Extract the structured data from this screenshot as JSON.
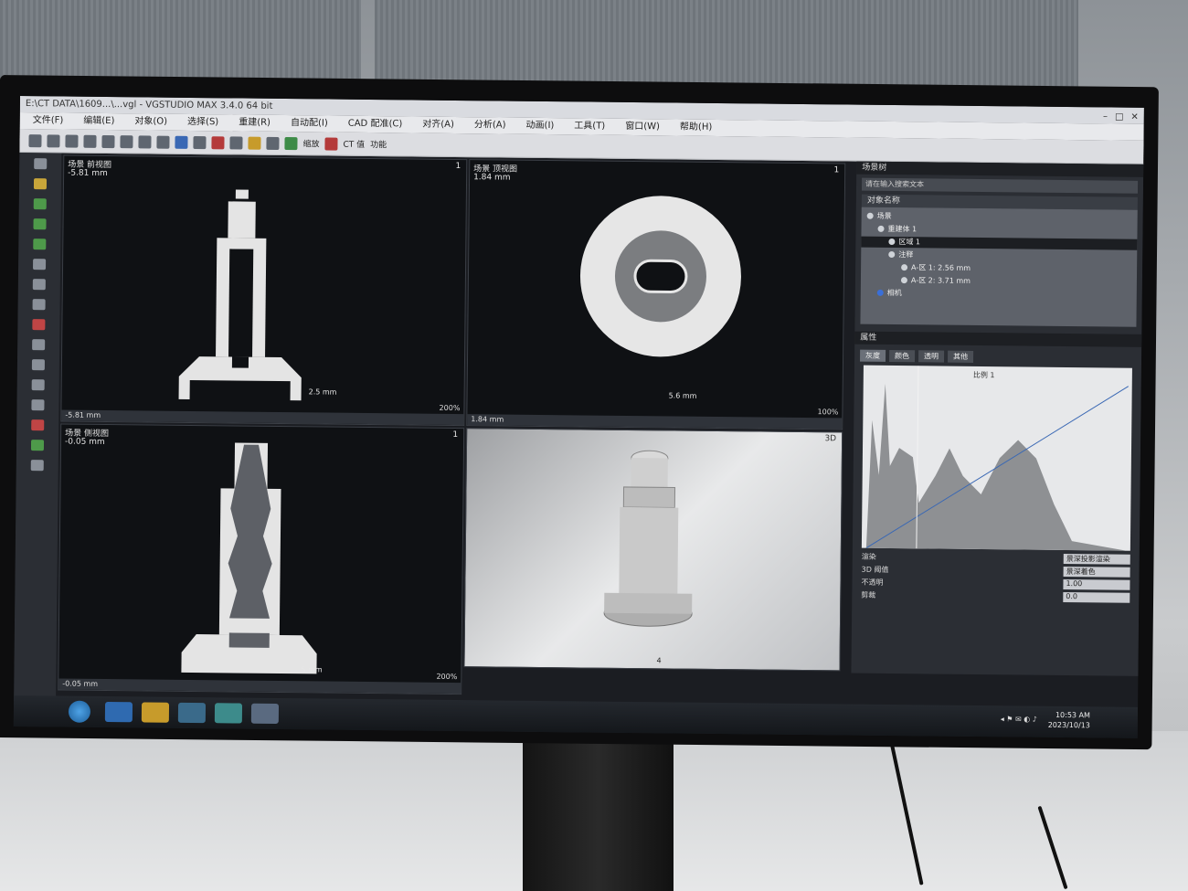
{
  "window": {
    "title": "E:\\CT DATA\\1609...\\...vgl - VGSTUDIO MAX 3.4.0 64 bit"
  },
  "menu": [
    "文件(F)",
    "编辑(E)",
    "对象(O)",
    "选择(S)",
    "重建(R)",
    "自动配(I)",
    "CAD 配准(C)",
    "对齐(A)",
    "分析(A)",
    "动画(I)",
    "工具(T)",
    "窗口(W)",
    "帮助(H)"
  ],
  "toolbar": {
    "label_1": "缩放",
    "label_2": "CT 值",
    "label_3": "功能"
  },
  "viewports": {
    "top_left": {
      "title": "场景 前视图",
      "depth": "-5.81 mm",
      "index": "1",
      "scale": "2.5 mm",
      "zoom": "200%",
      "status": "-5.81 mm"
    },
    "top_right": {
      "title": "场景 顶视图",
      "depth": "1.84 mm",
      "index": "1",
      "scale": "5.6 mm",
      "zoom": "100%",
      "status": "1.84 mm"
    },
    "bottom_left": {
      "title": "场景 侧视图",
      "depth": "-0.05 mm",
      "index": "1",
      "scale": "5 mm",
      "zoom": "200%",
      "status": "-0.05 mm"
    },
    "bottom_right": {
      "title": "3D",
      "index": "3D",
      "scale": "4"
    }
  },
  "right_panel": {
    "header": "场景树",
    "search_placeholder": "请在输入搜索文本",
    "tree_header": "对象名称",
    "tree": [
      "场景",
      "重建体 1",
      "区域 1",
      "注释",
      "A-区 1: 2.56 mm",
      "A-区 2: 3.71 mm",
      "相机"
    ],
    "props_header": "属性",
    "tabs": [
      "灰度",
      "颜色",
      "透明",
      "其他"
    ],
    "histogram_label": "比例 1",
    "props": [
      {
        "label": "渲染",
        "value": "景深投影渲染"
      },
      {
        "label": "3D 阈值",
        "value": "景深着色"
      },
      {
        "label": "不透明",
        "value": "1.00"
      },
      {
        "label": "剪裁",
        "value": "0.0"
      }
    ]
  },
  "taskbar": {
    "time": "10:53 AM",
    "date": "2023/10/13"
  }
}
